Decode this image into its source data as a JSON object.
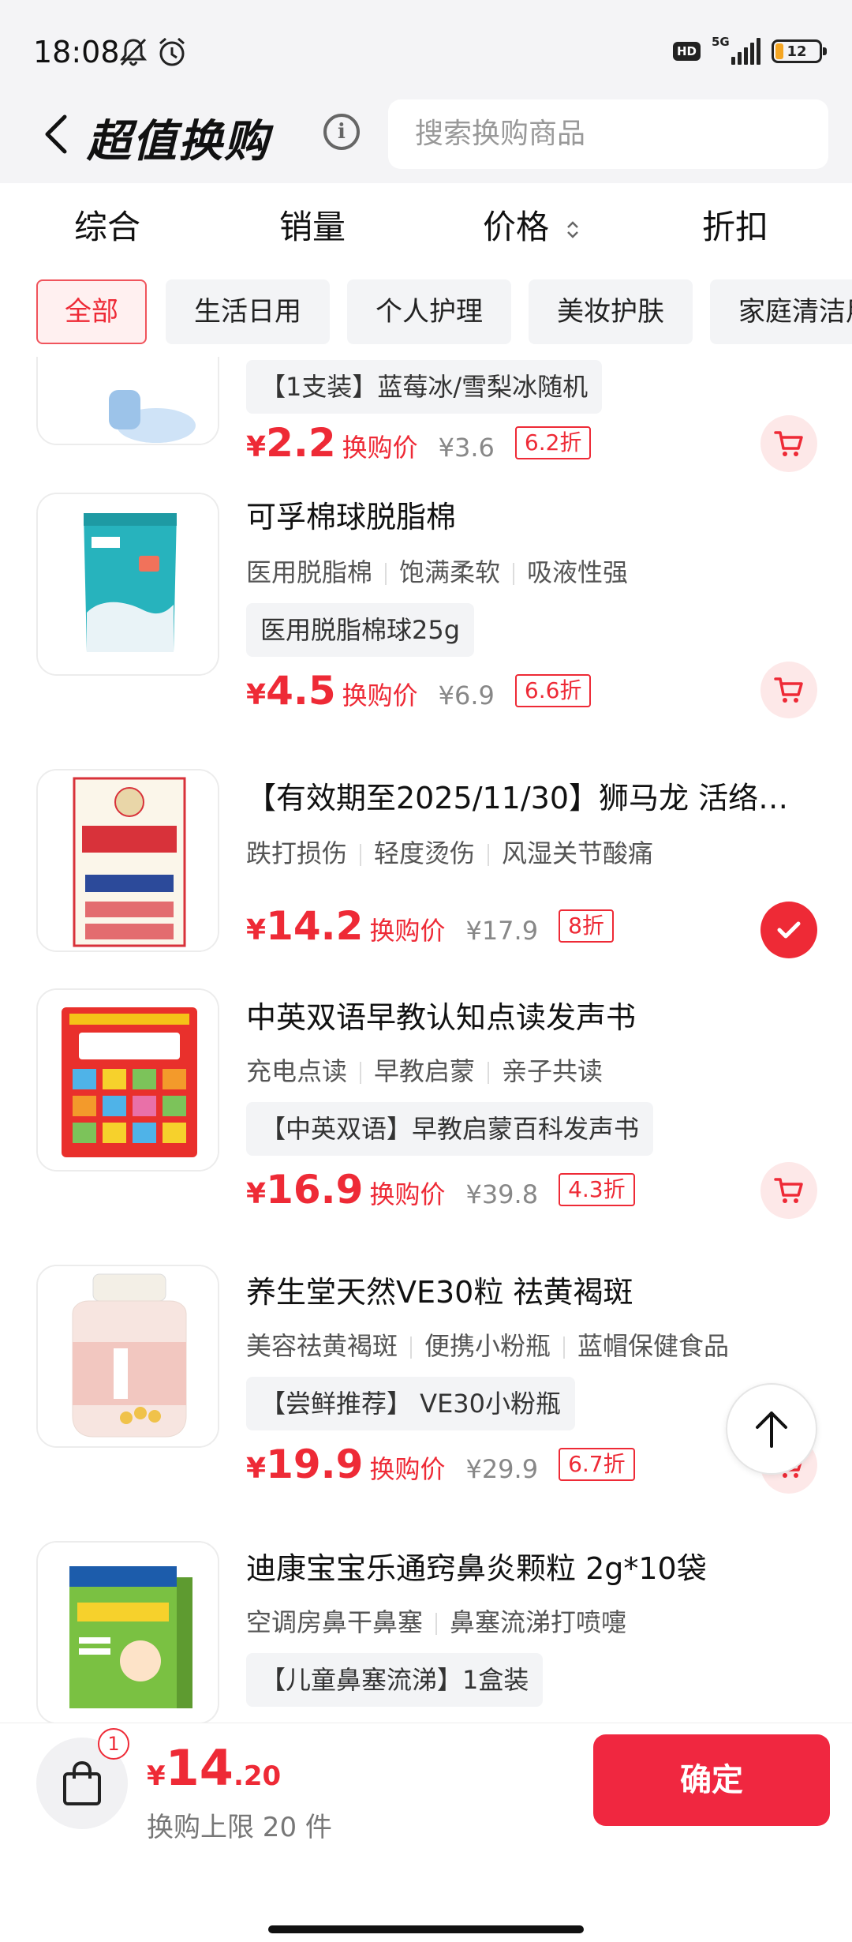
{
  "status_bar": {
    "time": "18:08",
    "hd_label": "HD",
    "network": "5G",
    "battery": "12"
  },
  "header": {
    "title": "超值换购",
    "info_icon": "i",
    "search_placeholder": "搜索换购商品"
  },
  "sort_tabs": [
    "综合",
    "销量",
    "价格",
    "折扣"
  ],
  "categories": [
    "全部",
    "生活日用",
    "个人护理",
    "美妆护肤",
    "家庭清洁用"
  ],
  "active_category": "全部",
  "products": [
    {
      "spec": "【1支装】蓝莓冰/雪梨冰随机",
      "price": "2.2",
      "price_label": "换购价",
      "original": "¥3.6",
      "discount": "6.2折",
      "selected": false
    },
    {
      "name": "可孚棉球脱脂棉",
      "tags": [
        "医用脱脂棉",
        "饱满柔软",
        "吸液性强"
      ],
      "spec": "医用脱脂棉球25g",
      "price": "4.5",
      "price_label": "换购价",
      "original": "¥6.9",
      "discount": "6.6折",
      "selected": false
    },
    {
      "name": "【有效期至2025/11/30】狮马龙 活络…",
      "tags": [
        "跌打损伤",
        "轻度烫伤",
        "风湿关节酸痛"
      ],
      "price": "14.2",
      "price_label": "换购价",
      "original": "¥17.9",
      "discount": "8折",
      "selected": true
    },
    {
      "name": "中英双语早教认知点读发声书",
      "tags": [
        "充电点读",
        "早教启蒙",
        "亲子共读"
      ],
      "spec": "【中英双语】早教启蒙百科发声书",
      "price": "16.9",
      "price_label": "换购价",
      "original": "¥39.8",
      "discount": "4.3折",
      "selected": false
    },
    {
      "name": "养生堂天然VE30粒 祛黄褐斑",
      "tags": [
        "美容祛黄褐斑",
        "便携小粉瓶",
        "蓝帽保健食品"
      ],
      "spec": "【尝鲜推荐】 VE30小粉瓶",
      "price": "19.9",
      "price_label": "换购价",
      "original": "¥29.9",
      "discount": "6.7折",
      "selected": false
    },
    {
      "name": "迪康宝宝乐通窍鼻炎颗粒 2g*10袋",
      "tags": [
        "空调房鼻干鼻塞",
        "鼻塞流涕打喷嚏"
      ],
      "spec": "【儿童鼻塞流涕】1盒装",
      "selected": false
    }
  ],
  "bottom": {
    "cart_count": "1",
    "currency": "¥",
    "total_int": "14",
    "total_dec": ".20",
    "limit_text": "换购上限 20 件",
    "confirm_label": "确定"
  },
  "colors": {
    "accent": "#ee2a36",
    "confirm": "#f02740",
    "header_bg": "#f4f4f6"
  }
}
